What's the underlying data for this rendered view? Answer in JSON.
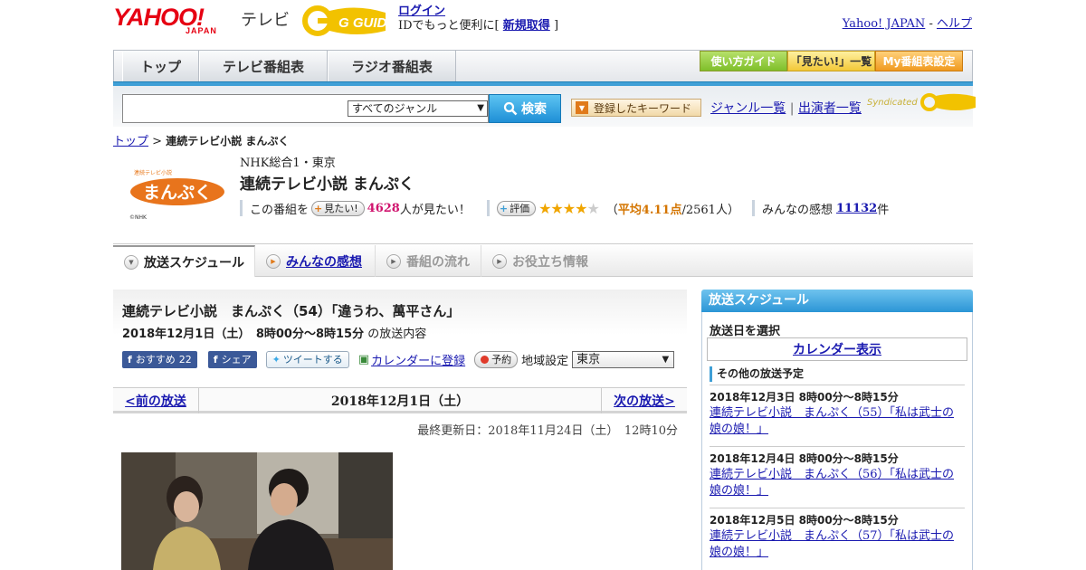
{
  "header": {
    "logo_yahoo": "YAHOO!",
    "logo_japan": "JAPAN",
    "logo_tv": "テレビ",
    "gguide": "G GUIDE",
    "login_label": "ログイン",
    "login_promo_prefix": "IDでもっと便利に[",
    "signup_label": "新規取得",
    "login_promo_suffix": "]",
    "yahoo_japan_link": "Yahoo! JAPAN",
    "link_sep": " - ",
    "help_link": "ヘルプ"
  },
  "nav": {
    "tabs": [
      {
        "label": "トップ"
      },
      {
        "label": "テレビ番組表"
      },
      {
        "label": "ラジオ番組表"
      }
    ],
    "right_buttons": [
      {
        "label": "使い方ガイド",
        "color": "#8bc34a"
      },
      {
        "label": "「見たい!」一覧",
        "color": "#f5c842"
      },
      {
        "label": "My番組表設定",
        "color": "#f0a030"
      }
    ]
  },
  "search": {
    "input_value": "",
    "genre_selected": "すべてのジャンル",
    "button_label": "検索",
    "keyword_button": "登録したキーワード",
    "genre_list_link": "ジャンル一覧",
    "link_sep": "|",
    "cast_list_link": "出演者一覧",
    "syndicated_label": "Syndicated"
  },
  "breadcrumb": {
    "top": "トップ",
    "sep": ">",
    "current": "連続テレビ小説 まんぷく"
  },
  "program": {
    "logo_text": "まんぷく",
    "logo_small": "連続テレビ小説",
    "logo_credit": "©NHK",
    "channel": "NHK総合1・東京",
    "title": "連続テレビ小説 まんぷく",
    "want_prefix": "この番組を",
    "want_button": "見たい!",
    "want_count": "4628",
    "want_suffix": "人が見たい！",
    "rate_button": "評価",
    "rating_value": 4.11,
    "rating_open": "（",
    "rating_avg_label": "平均4.11点",
    "rating_people": "/2561人）",
    "impressions_label": "みんなの感想",
    "impressions_count": "11132",
    "impressions_suffix": "件"
  },
  "tabs": [
    {
      "label": "放送スケジュール",
      "active": true
    },
    {
      "label": "みんなの感想",
      "link": true
    },
    {
      "label": "番組の流れ",
      "disabled": true
    },
    {
      "label": "お役立ち情報",
      "disabled": true
    }
  ],
  "episode": {
    "title": "連続テレビ小説　まんぷく（54）「違うわ、萬平さん」",
    "datetime": "2018年12月1日（土）　8時00分～8時15分",
    "datetime_suffix": "の放送内容",
    "fb_recommend": "おすすめ",
    "fb_recommend_count": "22",
    "fb_share": "シェア",
    "tweet": "ツイートする",
    "calendar_register": "カレンダーに登録",
    "reserve": "予約",
    "region_label": "地域設定",
    "region_selected": "東京"
  },
  "pager": {
    "prev": "<前の放送",
    "date": "2018年12月1日（土）",
    "next": "次の放送>"
  },
  "updated": "最終更新日：2018年11月24日（土）　12時10分",
  "sidebar": {
    "header": "放送スケジュール",
    "select_label": "放送日を選択",
    "calendar_button": "カレンダー表示",
    "other_header": "その他の放送予定",
    "broadcasts": [
      {
        "datetime": "2018年12月3日 8時00分～8時15分",
        "title": "連続テレビ小説　まんぷく（55）「私は武士の娘の娘！」"
      },
      {
        "datetime": "2018年12月4日 8時00分～8時15分",
        "title": "連続テレビ小説　まんぷく（56）「私は武士の娘の娘！」"
      },
      {
        "datetime": "2018年12月5日 8時00分～8時15分",
        "title": "連続テレビ小説　まんぷく（57）「私は武士の娘の娘！」"
      }
    ]
  },
  "colors": {
    "yahoo_red": "#e60012",
    "accent_blue": "#3f9fd6",
    "link": "#1a1ab0",
    "want_pink": "#d0146e",
    "star": "#f0a500"
  }
}
